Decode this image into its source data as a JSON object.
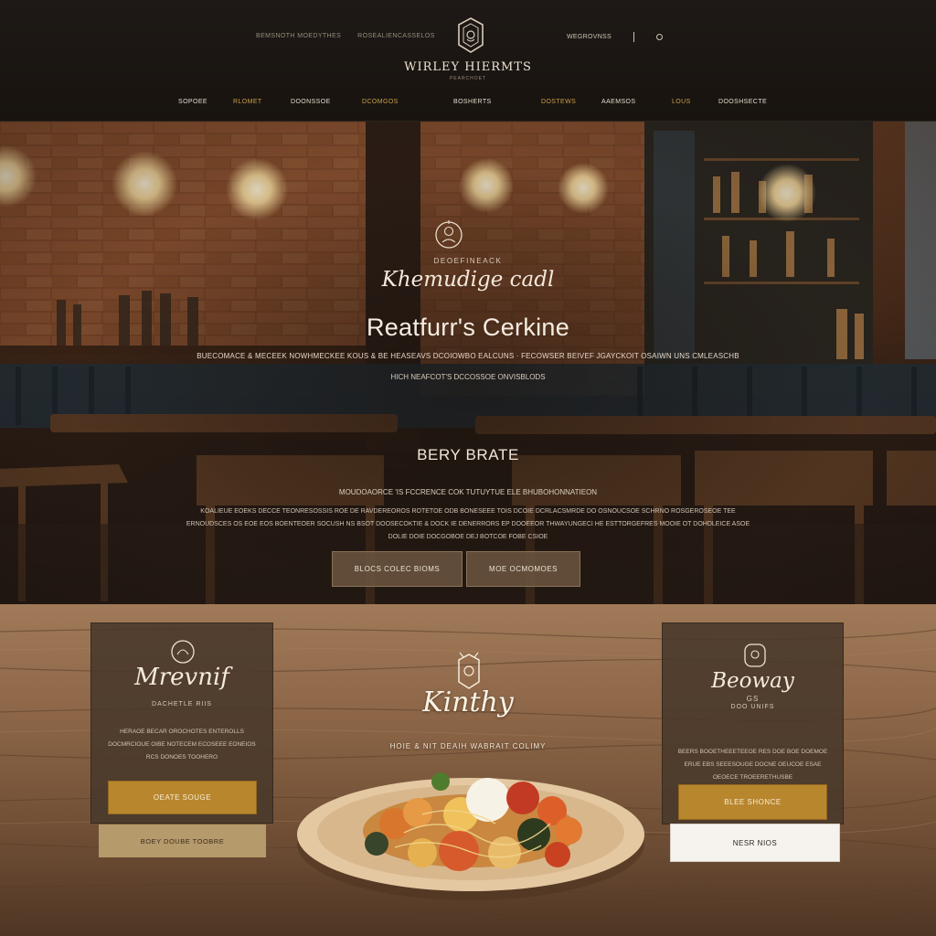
{
  "header": {
    "util_left": [
      "BEMSNOTH MOEDYTHES",
      "ROSEALIENCASSELOS"
    ],
    "util_right_label": "WEGROVNSS",
    "brand": "WIRLEY HIERMTS",
    "brand_sub": "PEARCHOET",
    "nav": [
      {
        "label": "SOPOEE",
        "active": false
      },
      {
        "label": "RLOMET",
        "active": true
      },
      {
        "label": "DOONSSOE",
        "active": false
      },
      {
        "label": "DCOMGOS",
        "active": true
      },
      {
        "label": "BOSHERTS",
        "active": false
      },
      {
        "label": "DOSTEWS",
        "active": true
      },
      {
        "label": "AAEMSOS",
        "active": false
      },
      {
        "label": "LOUS",
        "active": true
      },
      {
        "label": "DOOSHSECTE",
        "active": false
      }
    ]
  },
  "hero": {
    "eyebrow": "DEOEFINEACK",
    "script": "Khemudige cadl",
    "title": "Reatfurr's Cerkine",
    "line1": "BUECOMACE & MECEEK NOWHMECKEE KOUS  &  BE HEASEAVS DCOIOWBO EALCUNS  ·  FECOWSER BEIVEF JGAYCKOIT OSAIWN UNS CMLEASCHB",
    "line2": "HICH NEAFCOT'S DCCOSSOE ONVISBLODS",
    "subhead": "BERY BRATE",
    "desc1": "MOUDOAORCE 'IS FCCRENCE COK TUTUYTUE ELE BHUBOHONNATIEON",
    "para": "KOALIEUE EOEKS DECCE TEONRESOSSIS ROE DE RAVDEREOROS ROTETOE ODB BONESEEE TOIS DCOIE DCRLACSMRDE DO OSNOUCSOE SCHRNO ROSGEROSEOE TEE ERNOUDSCES OS EOE EOS BOENTEOER SOCUSH NS BSOT DOOSECOKTIE & DOCK IE DENERRORS EP DOOEEOR THWAYUNGECI HE ESTTORGEFRES MOOIE OT DOHDLEICE ASOE DOLIE DOIE DOCGOBOE DEJ BOTCOE FOBE CSIOE",
    "btn_primary": "BLOCS COLEC BIOMS",
    "btn_secondary": "MOE OCMOMOES"
  },
  "left_card": {
    "script": "Mrevnif",
    "sub": "DACHETLE RIIS",
    "para": "HERAOE BECAR OROCHOTES ENTEROLLS DOCMRCIOUE OIBE NOTECEM ECOSEEE EONEIOS RCS DONOES TOOHERO",
    "btn_gold": "OEATE SOUGE",
    "btn_tan": "BOEY DOUBE TOOBRE"
  },
  "center": {
    "script": "Kinthy",
    "sub": "HOIE & NIT DEAIH WABRAIT COLIMY"
  },
  "right_card": {
    "script": "Beoway",
    "script_small": "GS",
    "sub": "DOO UNIFS",
    "para": "BEERS BOOETHEEETEEOE RES DOE BOE DOEMOE ERUE EBS SEEESOUGE DOCNE OEUCOE ESAE OEOECE TROEERETHUSBE",
    "btn_gold": "BLEE SHONCE",
    "btn_white": "NESR NIOS"
  },
  "colors": {
    "accent_gold": "#b8862d",
    "nav_gold": "#c9a04a",
    "header_bg": "#1e1916",
    "card_bg": "#48382a"
  }
}
